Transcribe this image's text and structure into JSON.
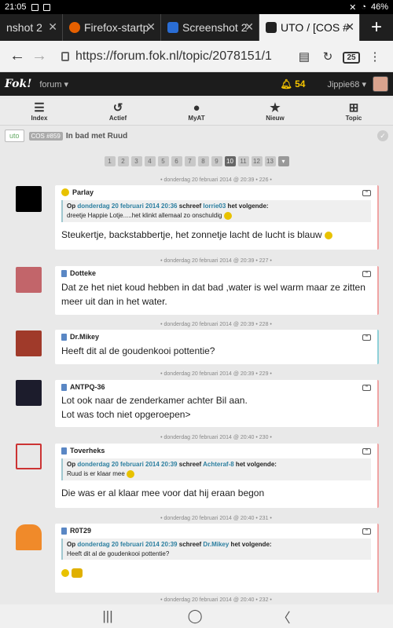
{
  "status": {
    "time": "21:05",
    "battery": "46%"
  },
  "tabs": [
    {
      "label": "nshot 2"
    },
    {
      "label": "Firefox-startp"
    },
    {
      "label": "Screenshot 2"
    },
    {
      "label": "UTO / [COS #"
    }
  ],
  "browser": {
    "url": "https://forum.fok.nl/topic/2078151/1",
    "tab_count": "25",
    "new_tab": "+"
  },
  "site": {
    "logo": "Fok!",
    "forum": "forum ▾",
    "notifications": "54",
    "user": "Jippie68 ▾"
  },
  "nav": [
    {
      "label": "Index",
      "icon": "menu-icon"
    },
    {
      "label": "Actief",
      "icon": "refresh-icon"
    },
    {
      "label": "MyAT",
      "icon": "person-icon"
    },
    {
      "label": "Nieuw",
      "icon": "star-icon"
    },
    {
      "label": "Topic",
      "icon": "plus-box-icon"
    }
  ],
  "topic": {
    "badge": "uto",
    "cos": "COS #859",
    "title": "In bad met Ruud"
  },
  "pager": {
    "pages": [
      "1",
      "2",
      "3",
      "4",
      "5",
      "6",
      "7",
      "8",
      "9",
      "10",
      "11",
      "12",
      "13",
      "▾"
    ],
    "current": "10"
  },
  "posts": [
    {
      "meta": "• donderdag 20 februari 2014 @ 20:39 • 226 •",
      "user": "Parlay",
      "quote": {
        "pre": "Op ",
        "date": "donderdag 20 februari 2014 20:36",
        "mid": " schreef ",
        "author": "lorrie03",
        "post": " het volgende:",
        "text": "dreetje Happie Lotje.....het klinkt allemaal zo onschuldig"
      },
      "body": "Steukertje, backstabbertje, het zonnetje lacht de lucht is blauw"
    },
    {
      "meta": "• donderdag 20 februari 2014 @ 20:39 • 227 •",
      "user": "Dotteke",
      "body": "Dat ze het niet koud hebben in dat bad ,water is wel warm maar ze zitten meer uit dan in het water."
    },
    {
      "meta": "• donderdag 20 februari 2014 @ 20:39 • 228 •",
      "user": "Dr.Mikey",
      "body": "Heeft dit al de goudenkooi pottentie?"
    },
    {
      "meta": "• donderdag 20 februari 2014 @ 20:39 • 229 •",
      "user": "ANTPQ-36",
      "body": "Lot ook naar de zenderkamer achter Bil aan.",
      "body2": "Lot was toch niet opgeroepen>"
    },
    {
      "meta": "• donderdag 20 februari 2014 @ 20:40 • 230 •",
      "user": "Toverheks",
      "quote": {
        "pre": "Op ",
        "date": "donderdag 20 februari 2014 20:39",
        "mid": " schreef ",
        "author": "Achteraf-8",
        "post": " het volgende:",
        "text": "Ruud is er klaar mee"
      },
      "body": "Die was er al klaar mee voor dat hij eraan begon"
    },
    {
      "meta": "• donderdag 20 februari 2014 @ 20:40 • 231 •",
      "user": "R0T29",
      "quote": {
        "pre": "Op ",
        "date": "donderdag 20 februari 2014 20:39",
        "mid": " schreef ",
        "author": "Dr.Mikey",
        "post": " het volgende:",
        "text": "Heeft dit al de goudenkooi pottentie?"
      }
    }
  ],
  "next_meta": "• donderdag 20 februari 2014 @ 20:40 • 232 •"
}
